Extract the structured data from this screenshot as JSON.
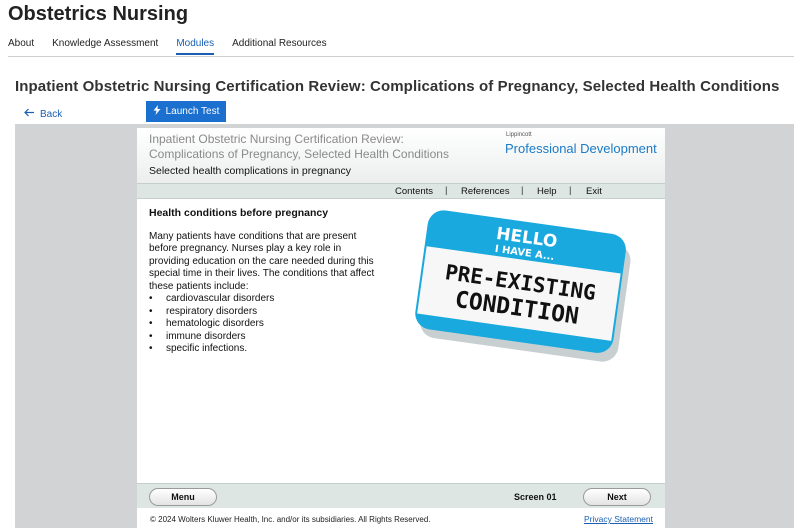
{
  "site": {
    "title": "Obstetrics Nursing"
  },
  "nav": {
    "items": [
      {
        "label": "About"
      },
      {
        "label": "Knowledge Assessment"
      },
      {
        "label": "Modules",
        "active": true
      },
      {
        "label": "Additional Resources"
      }
    ]
  },
  "course": {
    "title": "Inpatient Obstetric Nursing Certification Review: Complications of Pregnancy, Selected Health Conditions"
  },
  "actions": {
    "back_label": "Back",
    "launch_label": "Launch Test"
  },
  "player": {
    "title_line1": "Inpatient Obstetric Nursing Certification Review:",
    "title_line2": "Complications of Pregnancy, Selected Health Conditions",
    "subtitle": "Selected health complications in pregnancy",
    "brand_small": "Lippincott",
    "brand_big": "Professional Development",
    "menu": {
      "contents": "Contents",
      "references": "References",
      "help": "Help",
      "exit": "Exit"
    },
    "content": {
      "heading": "Health conditions before pregnancy",
      "paragraph": "Many patients have conditions that are present before pregnancy. Nurses play a key role in providing education on the care needed during this special time in their lives. The conditions that affect these patients include:",
      "list": [
        "cardiovascular disorders",
        "respiratory disorders",
        "hematologic disorders",
        "immune disorders",
        "specific infections."
      ]
    },
    "badge": {
      "line1": "HELLO",
      "line2": "I HAVE A...",
      "line3": "PRE-EXISTING",
      "line4": "CONDITION"
    },
    "footer": {
      "menu_label": "Menu",
      "screen_label": "Screen 01",
      "next_label": "Next"
    },
    "copyright": "© 2024 Wolters Kluwer Health, Inc. and/or its subsidiaries. All Rights Reserved.",
    "privacy_label": "Privacy Statement"
  },
  "colors": {
    "accent": "#1a6fcf",
    "link": "#1a5fb4",
    "brand_blue": "#1b7bc6",
    "badge_blue": "#19a9de",
    "frame_gray": "#d2d3d5"
  }
}
